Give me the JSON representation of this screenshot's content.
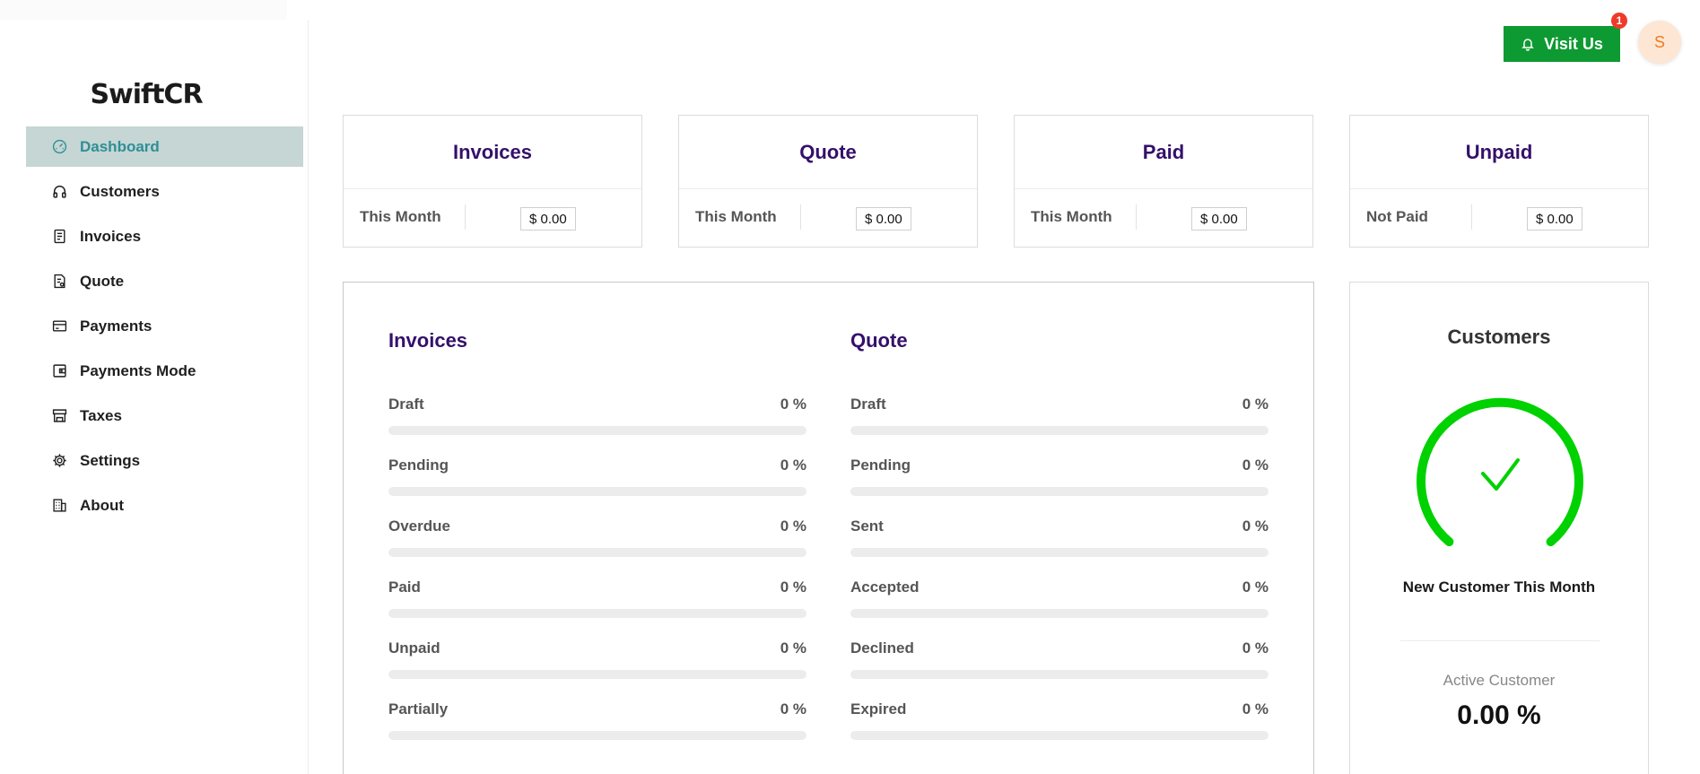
{
  "app": {
    "logo": "SwiftCR"
  },
  "sidebar": {
    "items": [
      {
        "label": "Dashboard",
        "icon": "dashboard-icon",
        "active": true
      },
      {
        "label": "Customers",
        "icon": "headphones-icon",
        "active": false
      },
      {
        "label": "Invoices",
        "icon": "document-icon",
        "active": false
      },
      {
        "label": "Quote",
        "icon": "file-icon",
        "active": false
      },
      {
        "label": "Payments",
        "icon": "credit-card-icon",
        "active": false
      },
      {
        "label": "Payments Mode",
        "icon": "wallet-icon",
        "active": false
      },
      {
        "label": "Taxes",
        "icon": "shop-icon",
        "active": false
      },
      {
        "label": "Settings",
        "icon": "gear-icon",
        "active": false
      },
      {
        "label": "About",
        "icon": "building-icon",
        "active": false
      }
    ]
  },
  "header": {
    "visit_label": "Visit Us",
    "visit_icon": "bell-icon",
    "notification_count": "1",
    "avatar_initial": "S"
  },
  "cards": [
    {
      "title": "Invoices",
      "label": "This Month",
      "value": "$ 0.00"
    },
    {
      "title": "Quote",
      "label": "This Month",
      "value": "$ 0.00"
    },
    {
      "title": "Paid",
      "label": "This Month",
      "value": "$ 0.00"
    },
    {
      "title": "Unpaid",
      "label": "Not Paid",
      "value": "$ 0.00"
    }
  ],
  "invoices_progress": {
    "title": "Invoices",
    "items": [
      {
        "label": "Draft",
        "percent_text": "0 %",
        "percent": 0
      },
      {
        "label": "Pending",
        "percent_text": "0 %",
        "percent": 0
      },
      {
        "label": "Overdue",
        "percent_text": "0 %",
        "percent": 0
      },
      {
        "label": "Paid",
        "percent_text": "0 %",
        "percent": 0
      },
      {
        "label": "Unpaid",
        "percent_text": "0 %",
        "percent": 0
      },
      {
        "label": "Partially",
        "percent_text": "0 %",
        "percent": 0
      }
    ]
  },
  "quote_progress": {
    "title": "Quote",
    "items": [
      {
        "label": "Draft",
        "percent_text": "0 %",
        "percent": 0
      },
      {
        "label": "Pending",
        "percent_text": "0 %",
        "percent": 0
      },
      {
        "label": "Sent",
        "percent_text": "0 %",
        "percent": 0
      },
      {
        "label": "Accepted",
        "percent_text": "0 %",
        "percent": 0
      },
      {
        "label": "Declined",
        "percent_text": "0 %",
        "percent": 0
      },
      {
        "label": "Expired",
        "percent_text": "0 %",
        "percent": 0
      }
    ]
  },
  "customers": {
    "title": "Customers",
    "subtitle": "New Customer This Month",
    "active_label": "Active Customer",
    "active_value": "0.00 %",
    "gauge_icon": "checkmark-icon"
  },
  "colors": {
    "accent": "#34106a",
    "active_nav_bg": "#c5d6d4",
    "active_nav_text": "#2f8f95",
    "visit_button": "#0e9a32",
    "gauge": "#00d100",
    "badge": "#ef3a2a"
  }
}
